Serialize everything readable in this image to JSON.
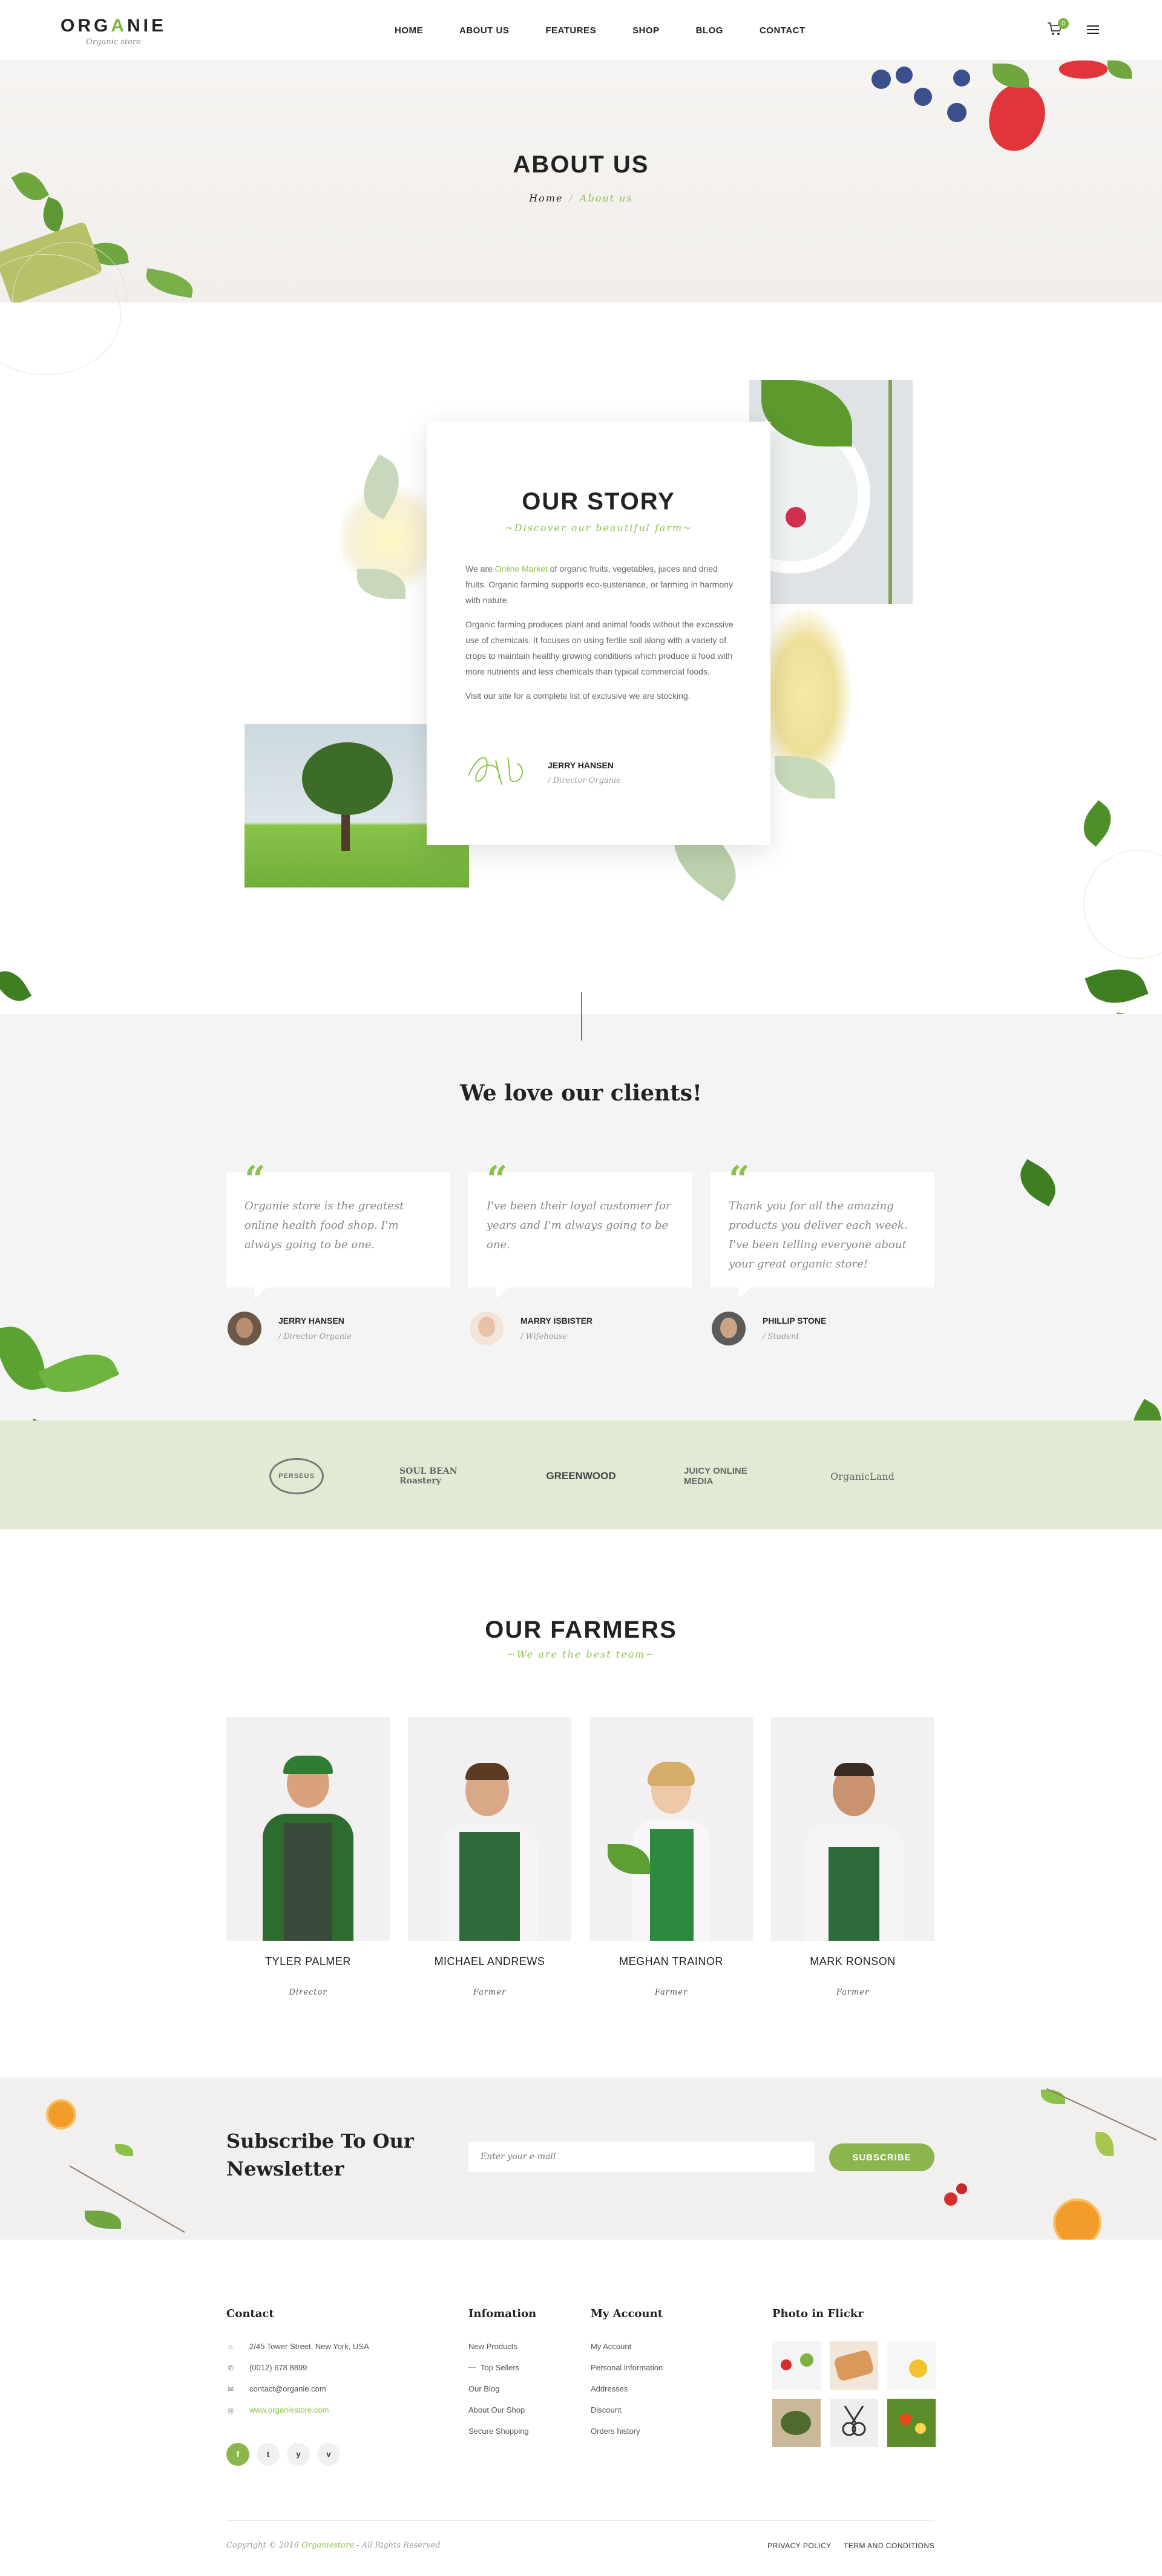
{
  "header": {
    "logo_pre": "ORG",
    "logo_x": "A",
    "logo_post": "NIE",
    "logo_sub": "Organic store",
    "nav": [
      "HOME",
      "ABOUT US",
      "FEATURES",
      "SHOP",
      "BLOG",
      "CONTACT"
    ],
    "cart_count": "0"
  },
  "banner": {
    "title": "ABOUT US",
    "crumb_home": "Home",
    "crumb_sep": "/",
    "crumb_current": "About us"
  },
  "story": {
    "title": "OUR STORY",
    "subtitle": "~Discover our beautiful farm~",
    "p1_pre": "We are ",
    "p1_link": "Online Market",
    "p1_post": " of organic fruits, vegetables, juices and dried fruits. Organic farming supports eco-sustenance, or farming in harmony with nature.",
    "p2": "Organic farming produces plant and animal foods without the excessive use of chemicals. It focuses on using fertile soil along with a variety of crops to maintain healthy growing conditions which produce a food with more nutrients and less chemicals than typical commercial foods.",
    "p3": "Visit our site for a complete list of exclusive we are stocking.",
    "sign_name": "JERRY HANSEN",
    "sign_role": "/ Director Organie"
  },
  "clients": {
    "title": "We love our clients!",
    "items": [
      {
        "quote": "Organie  store is the greatest online health food shop. I'm always going to be one.",
        "name": "JERRY HANSEN",
        "role": "/ Director Organie"
      },
      {
        "quote": "I've been their loyal customer for years and I'm always going to be one.",
        "name": "MARRY ISBISTER",
        "role": "/ Wifehouse"
      },
      {
        "quote": "Thank you for all the amazing products you deliver each week. I've been telling everyone about your great organic store!",
        "name": "PHILLIP STONE",
        "role": "/ Student"
      }
    ]
  },
  "brands": [
    "PERSEUS",
    "SOUL BEAN Roastery",
    "GREENWOOD",
    "JUICY ONLINE MEDIA",
    "OrganicLand"
  ],
  "farmers": {
    "title": "OUR FARMERS",
    "subtitle": "~We are the best team~",
    "items": [
      {
        "name": "TYLER PALMER",
        "role": "Director"
      },
      {
        "name": "MICHAEL ANDREWS",
        "role": "Farmer"
      },
      {
        "name": "MEGHAN TRAINOR",
        "role": "Farmer"
      },
      {
        "name": "MARK RONSON",
        "role": "Farmer"
      }
    ]
  },
  "newsletter": {
    "title_line1": "Subscribe To Our",
    "title_line2": "Newsletter",
    "placeholder": "Enter your e-mail",
    "button": "SUBSCRIBE"
  },
  "footer": {
    "contact_title": "Contact",
    "address": "2/45 Tower Street, New York, USA",
    "phone": "(0012) 678 8899",
    "email": "contact@organie.com",
    "website": "www.organiestore.com",
    "social": [
      "f",
      "t",
      "y",
      "v"
    ],
    "info_title": "Infomation",
    "info_links": [
      "New Products",
      "Top Sellers",
      "Our Blog",
      "About Our Shop",
      "Secure Shopping"
    ],
    "account_title": "My Account",
    "account_links": [
      "My Account",
      "Personal information",
      "Addresses",
      "Discount",
      "Orders history"
    ],
    "flickr_title": "Photo in Flickr",
    "copyright_pre": "Copyright © 2016 ",
    "copyright_brand": "Organiestore",
    "copyright_post": " - All Rights Reserved",
    "legal": [
      "PRIVACY POLICY",
      "TERM AND CONDITIONS"
    ]
  },
  "colors": {
    "accent": "#8bc34a",
    "button": "#8bb54e",
    "brand_band": "#e1ebd4",
    "clients_bg": "#f5f4f4"
  }
}
